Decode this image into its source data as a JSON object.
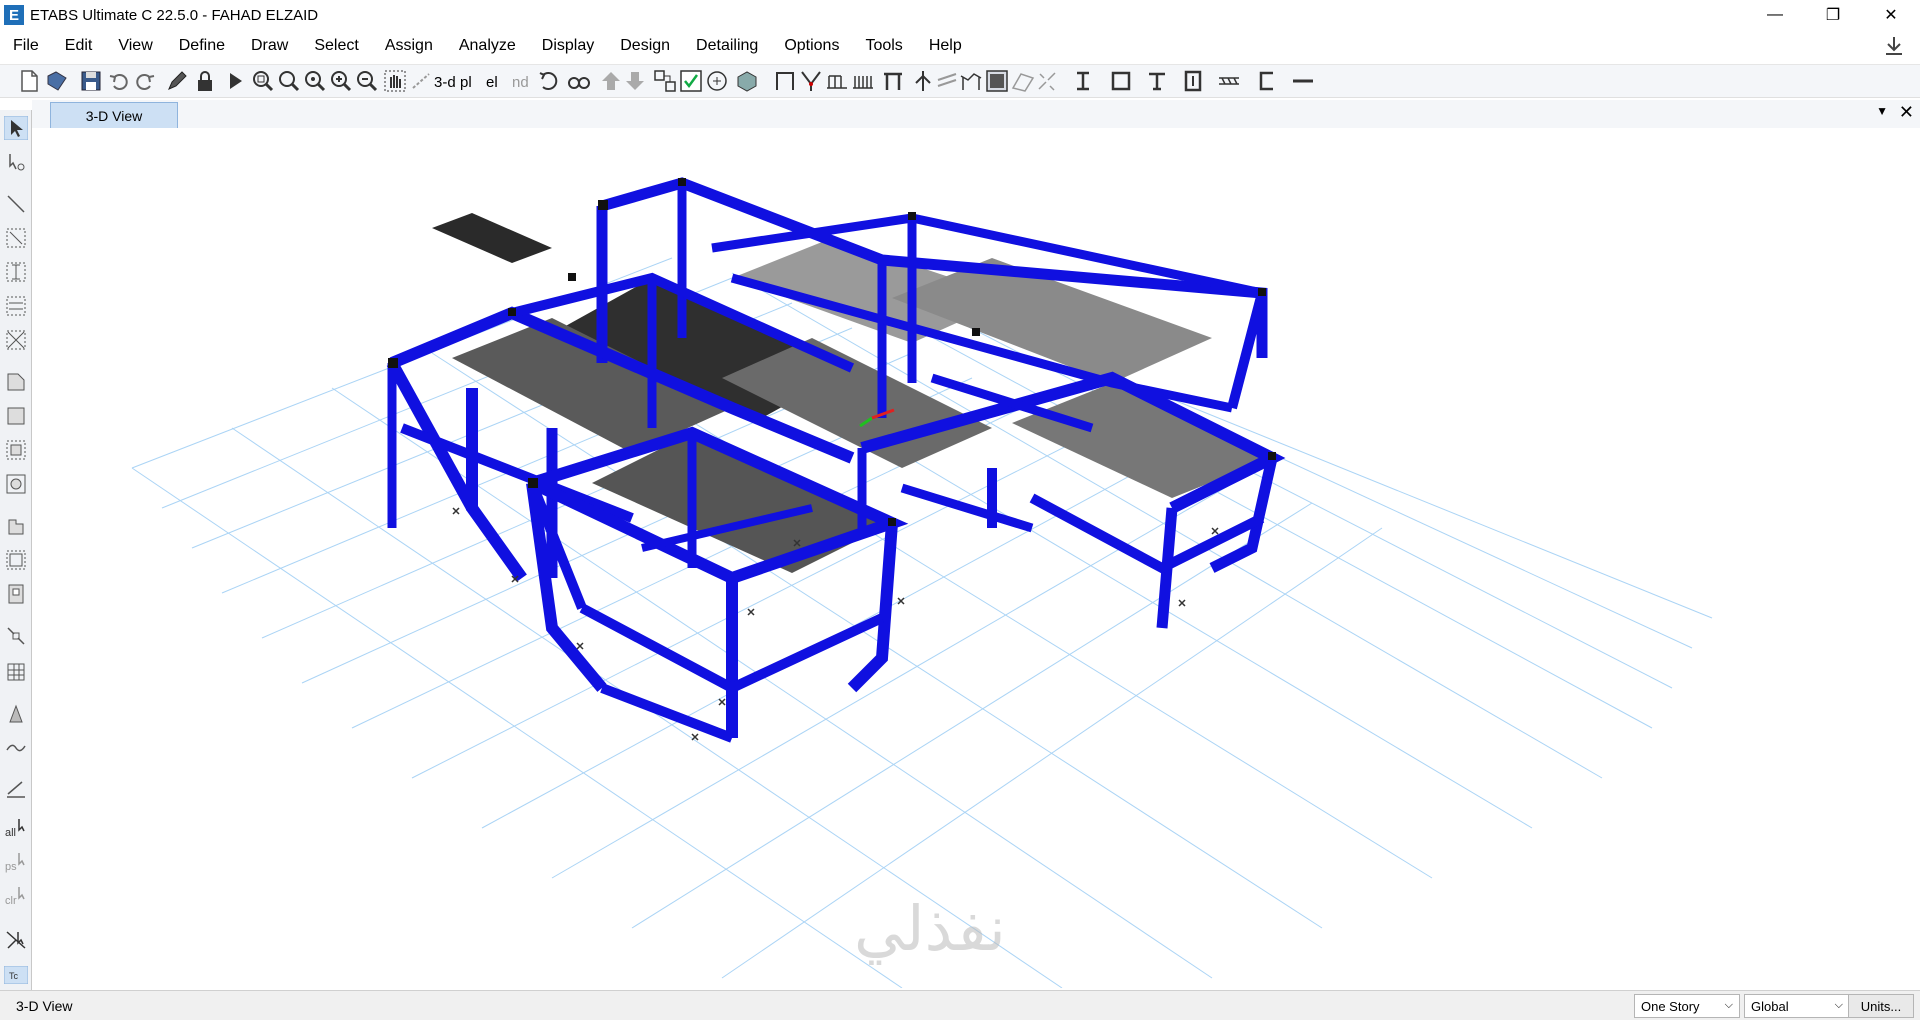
{
  "window": {
    "title": "ETABS Ultimate C 22.5.0 - FAHAD ELZAID",
    "logo_letter": "E",
    "minimize": "—",
    "restore": "❐",
    "close": "✕"
  },
  "menu": [
    "File",
    "Edit",
    "View",
    "Define",
    "Draw",
    "Select",
    "Assign",
    "Analyze",
    "Display",
    "Design",
    "Detailing",
    "Options",
    "Tools",
    "Help"
  ],
  "toolbar": {
    "labels": {
      "view_3d": "3-d",
      "view_plan": "pl",
      "view_elev": "el",
      "view_nd": "nd"
    }
  },
  "tabs": {
    "active": "3-D View"
  },
  "statusbar": {
    "view_name": "3-D View",
    "story_option": "One Story",
    "coord_system": "Global",
    "units_button": "Units..."
  },
  "watermark": "نفذلي",
  "colors": {
    "frame": "#1010e0",
    "grid": "#8fc6f2",
    "slab": "#3a3a3a",
    "tab_active": "#cde0f4"
  }
}
